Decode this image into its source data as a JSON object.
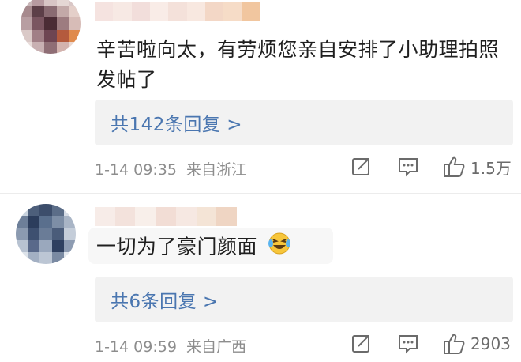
{
  "comments": [
    {
      "text_line1": "辛苦啦向太，有劳烦您亲自安排了小助理拍照",
      "text_line2": "发帖了",
      "reply_link": "共142条回复 >",
      "time": "1-14 09:35",
      "location": "来自浙江",
      "likes": "1.5万"
    },
    {
      "text_line1": "一切为了豪门颜面",
      "emoji": "laughing-tears-emoji",
      "reply_link": "共6条回复 >",
      "time": "1-14 09:59",
      "location": "来自广西",
      "likes": "2903"
    }
  ],
  "icons": {
    "share": "share-icon",
    "comment": "comment-icon",
    "like": "thumbs-up-icon"
  },
  "colors": {
    "link": "#4a76b0",
    "meta": "#8d8d8d",
    "reply_bg": "#f2f2f2"
  }
}
